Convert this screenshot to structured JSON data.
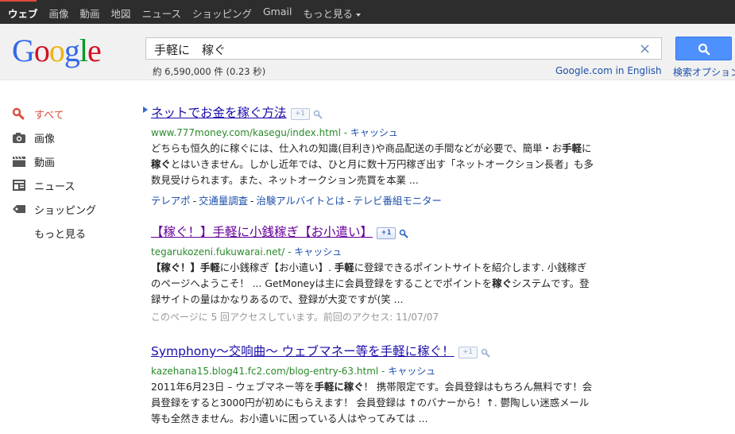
{
  "topnav": [
    "ウェブ",
    "画像",
    "動画",
    "地図",
    "ニュース",
    "ショッピング",
    "Gmail",
    "もっと見る"
  ],
  "logo": "Google",
  "search": {
    "query": "手軽に　稼ぐ",
    "clear": "×"
  },
  "stats": "約 6,590,000 件 (0.23 秒)",
  "header_links": {
    "english": "Google.com in English",
    "advanced": "検索オプション"
  },
  "leftnav": [
    {
      "icon": "search-icon",
      "label": "すべて",
      "active": true
    },
    {
      "icon": "camera-icon",
      "label": "画像"
    },
    {
      "icon": "film-icon",
      "label": "動画"
    },
    {
      "icon": "newspaper-icon",
      "label": "ニュース"
    },
    {
      "icon": "tag-icon",
      "label": "ショッピング"
    },
    {
      "icon": "",
      "label": "もっと見る"
    }
  ],
  "plusone": "+1",
  "results": [
    {
      "title": "ネットでお金を稼ぐ方法",
      "url": "www.777money.com/kasegu/index.html",
      "cache": "キャッシュ",
      "snippet": [
        "どちらも恒久的に稼ぐには、仕入れの知識(目利き)や商品配送の手間などが必要で、簡単・お",
        "手軽",
        "に",
        "稼ぐ",
        "とはいきません。しかし近年では、ひと月に数十万円稼ぎ出す「ネットオークション長者」も多数見受けられます。また、ネットオークション売買を本業 ..."
      ],
      "sitelinks": [
        "テレアポ",
        "交通量調査",
        "治験アルバイトとは",
        "テレビ番組モニター"
      ]
    },
    {
      "title": "【稼ぐ！】手軽に小銭稼ぎ【お小遣い】",
      "url": "tegarukozeni.fukuwarai.net/",
      "cache": "キャッシュ",
      "snippet": [
        "【稼ぐ！】手軽",
        "に小銭稼ぎ【お小遣い】. ",
        "手軽",
        "に登録できるポイントサイトを紹介します. 小銭稼ぎのページへようこそ！ ... GetMoneyは主に会員登録をすることでポイントを",
        "稼ぐ",
        "システムです。登録サイトの量はかなりあるので、登録が大変ですが(笑 ..."
      ],
      "visits": "このページに 5 回アクセスしています。前回のアクセス: 11/07/07"
    },
    {
      "title": "Symphony～交响曲～ ウェブマネー等を手軽に稼ぐ！",
      "url": "kazehana15.blog41.fc2.com/blog-entry-63.html",
      "cache": "キャッシュ",
      "snippet": [
        "2011年6月23日 – ウェブマネー等を",
        "手軽に稼ぐ",
        "！ 携帯限定です。会員登録はもちろん無料です！会員登録をすると3000円が初めにもらえます！ 会員登録は ↑のバナーから！↑. 鬱陶しい迷惑メール等も全然きません。お小遣いに困っている人はやってみては ..."
      ]
    }
  ],
  "colors": {
    "link": "#1a0dab",
    "visited": "#660099",
    "url": "#2a8a2a",
    "active_nav": "#dd4b39",
    "search_button": "#4d90fe"
  }
}
